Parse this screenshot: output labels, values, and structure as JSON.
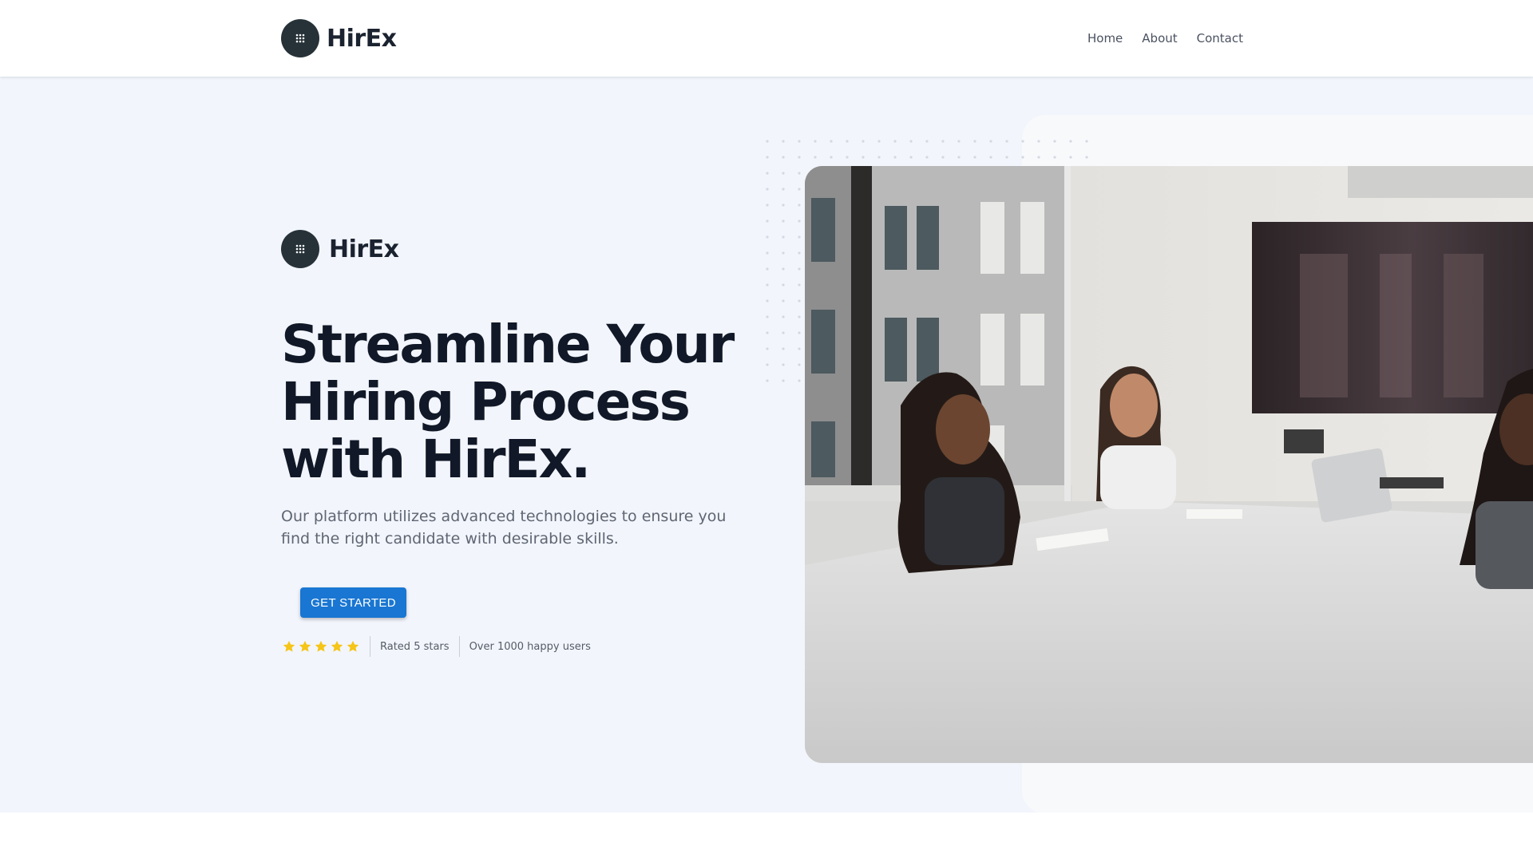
{
  "navbar": {
    "brand_name": "HirEx",
    "links": [
      {
        "label": "Home"
      },
      {
        "label": "About"
      },
      {
        "label": "Contact"
      }
    ]
  },
  "hero": {
    "brand_name": "HirEx",
    "headline": "Streamline Your Hiring Process with HirEx.",
    "subtext": "Our platform utilizes advanced technologies to ensure you find the right candidate with desirable skills.",
    "cta_label": "GET STARTED",
    "rating": {
      "stars": 5,
      "max_stars": 5,
      "rated_text": "Rated 5 stars",
      "users_text": "Over 1000 happy users"
    }
  },
  "colors": {
    "brand_dark": "#263238",
    "primary_button": "#1976d2",
    "hero_background": "#f2f5fc",
    "star": "#f5c518",
    "headline": "#111827"
  },
  "icons": {
    "logo": "grid-dots-icon",
    "rating": "star-icon"
  }
}
